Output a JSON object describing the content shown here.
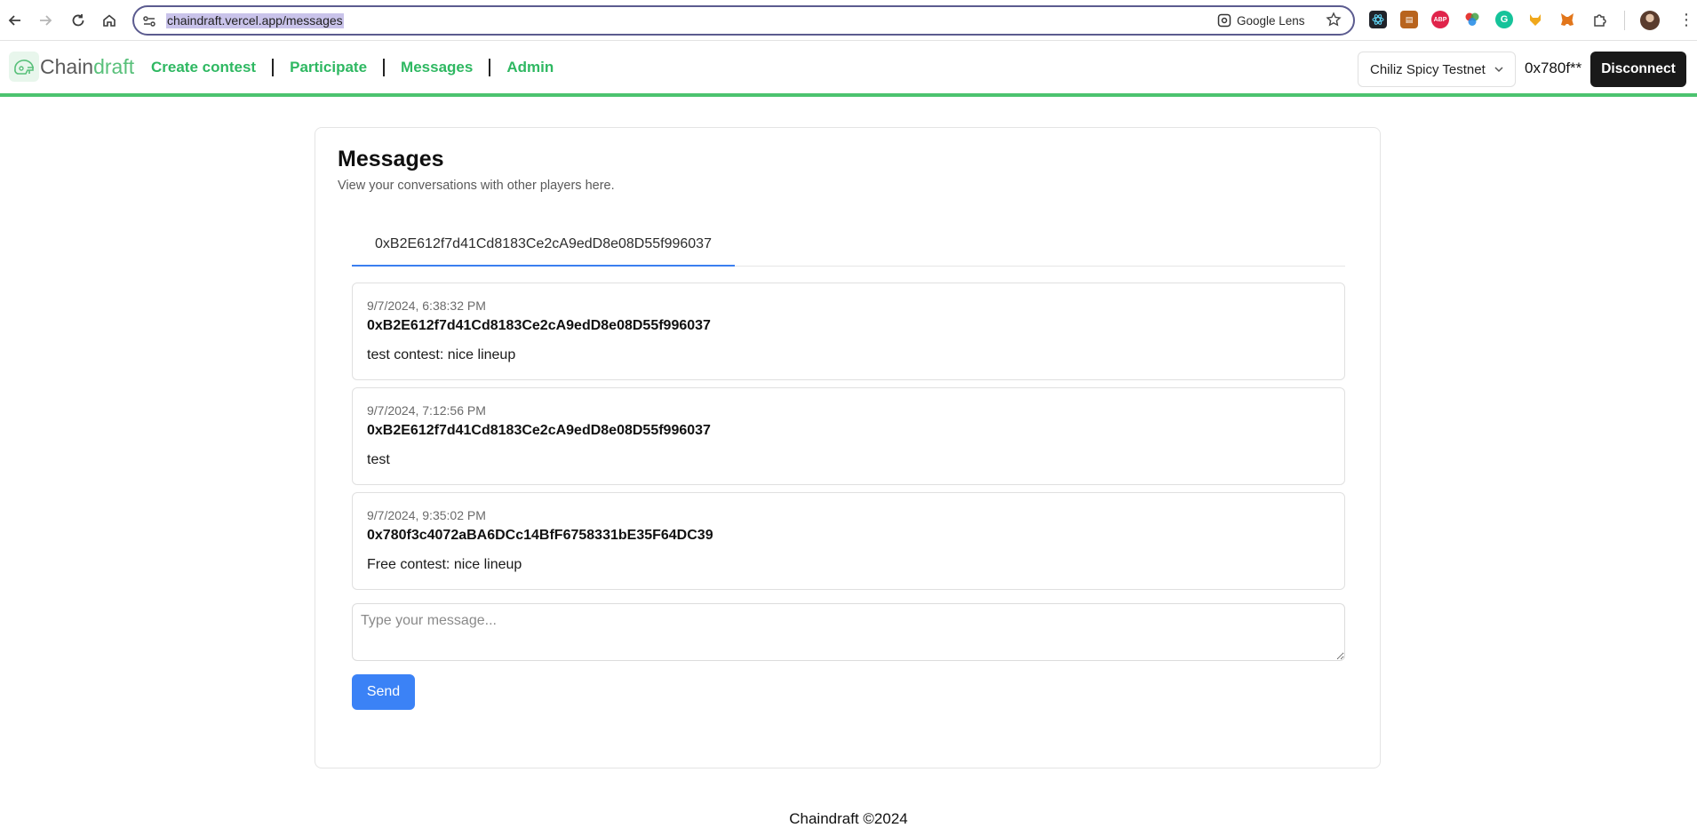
{
  "browser": {
    "url": "chaindraft.vercel.app/messages",
    "lens_label": "Google Lens",
    "extensions": [
      {
        "icon": "react-devtools-icon",
        "color": "#20232a"
      },
      {
        "icon": "wallet-extension-icon",
        "color": "#b8641e"
      },
      {
        "icon": "adblock-icon",
        "color": "#e0244b"
      },
      {
        "icon": "color-picker-icon",
        "color": "#6bbf2f"
      },
      {
        "icon": "grammarly-icon",
        "color": "#15c39a"
      },
      {
        "icon": "fox-head-icon",
        "color": "#f0a81c"
      },
      {
        "icon": "metamask-icon",
        "color": "#e2761b"
      }
    ]
  },
  "header": {
    "brand_prefix": "Chain",
    "brand_suffix": "draft",
    "nav": [
      "Create contest",
      "Participate",
      "Messages",
      "Admin"
    ],
    "network": "Chiliz Spicy Testnet",
    "address": "0x780f**",
    "disconnect": "Disconnect"
  },
  "main": {
    "title": "Messages",
    "subtitle": "View your conversations with other players here.",
    "tabs": [
      "0xB2E612f7d41Cd8183Ce2cA9edD8e08D55f996037"
    ],
    "messages": [
      {
        "time": "9/7/2024, 6:38:32 PM",
        "sender": "0xB2E612f7d41Cd8183Ce2cA9edD8e08D55f996037",
        "text": "test contest: nice lineup"
      },
      {
        "time": "9/7/2024, 7:12:56 PM",
        "sender": "0xB2E612f7d41Cd8183Ce2cA9edD8e08D55f996037",
        "text": "test"
      },
      {
        "time": "9/7/2024, 9:35:02 PM",
        "sender": "0x780f3c4072aBA6DCc14BfF6758331bE35F64DC39",
        "text": "Free contest: nice lineup"
      }
    ],
    "composer_placeholder": "Type your message...",
    "send": "Send"
  },
  "footer": {
    "text": "Chaindraft ©2024"
  },
  "colors": {
    "accent_green": "#2fb862",
    "tab_active": "#3b7ff0",
    "send_button": "#3b82f6"
  }
}
